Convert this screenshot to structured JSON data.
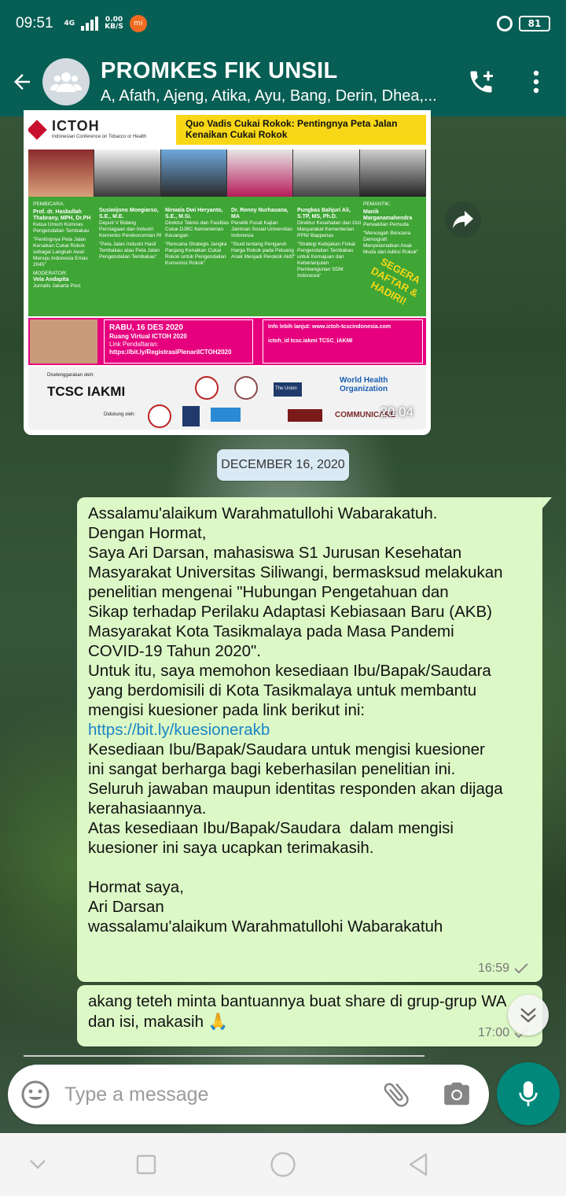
{
  "status_bar": {
    "time": "09:51",
    "network": "4G",
    "speed_value": "0.00",
    "speed_unit": "KB/S",
    "mi_label": "mi",
    "battery": "81"
  },
  "header": {
    "title": "PROMKES FIK UNSIL",
    "subtitle": "A, Afath, Ajeng, Atika, Ayu, Bang, Derin, Dhea,..."
  },
  "image_message": {
    "time": "20:04",
    "poster": {
      "logo": "ICTOH",
      "logo_sub": "Indonesian Conference on Tobacco or Health",
      "banner": "Quo Vadis Cukai Rokok: Pentingnya Peta Jalan Kenaikan Cukai Rokok",
      "speakers_label": "PEMBICARA:",
      "speakers": [
        {
          "name": "Prof. dr. Hasbullah Thabrany, MPH, Dr.PH",
          "role": "Ketua Umum Komnas Pengendalian Tembakau",
          "topic": "\"Pentingnya Peta Jalan Kenaikan Cukai Rokok sebagai Langkah Awal Menuju Indonesia Emas 2045\""
        },
        {
          "name": "Susiwijono Moegiarso, S.E., M.E.",
          "role": "Deputi V Bidang Perniagaan dan Industri Kemenko Perekonomian RI",
          "topic": "\"Peta Jalan Industri Hasil Tembakau atau Peta Jalan Pengendalian Tembakau\""
        },
        {
          "name": "Nirwala Dwi Heryanto, S.E., M.Si.",
          "role": "Direktur Teknis dan Fasilitas Cukai DJBC Kementerian Keuangan",
          "topic": "\"Rencana Strategis Jangka Panjang Kenaikan Cukai Rokok untuk Pengendalian Konsumsi Rokok\""
        },
        {
          "name": "Dr. Renny Nurhasana, MA",
          "role": "Peneliti Pusat Kajian Jaminan Sosial Universitas Indonesia",
          "topic": "\"Studi tentang Pengaruh Harga Rokok pada Peluang Anak Menjadi Perokok Aktif\""
        },
        {
          "name": "Pungkas Bahjuri Ali, S.TP, MS, Ph.D.",
          "role": "Direktur Kesehatan dan Gizi Masyarakat Kementerian PPN/ Bappenas",
          "topic": "\"Strategi Kebijakan Fiskal Pengendalian Tembakau untuk Kemajuan dan Keberlanjutan Pembangunan SDM Indonesia\""
        },
        {
          "name": "Manik Marganamahendra",
          "role": "Perwakilan Pemuda",
          "topic": "\"Mencegah Bencana Demografi: Menyelamatkan Anak Muda dari Adiksi Rokok\""
        }
      ],
      "commentator_label": "PEMANTIK:",
      "moderator_label": "MODERATOR:",
      "moderator": "Vela Andapita",
      "moderator_org": "Jurnalis Jakarta Post",
      "cta": "SEGERA DAFTAR & HADIRI!",
      "date": "RABU, 16 DES 2020",
      "venue": "Ruang Virtual ICTOH 2020",
      "link_label": "Link Pendaftaran:",
      "link": "https://bit.ly/RegistrasiPlenariICTOH2020",
      "info": "Info lebih lanjut: www.ictoh-tcscindonesia.com",
      "socials": "ictoh_id   tcsc.iakmi   TCSC_IAKMI",
      "organizer_label": "Diselenggarakan oleh:",
      "organizer": "TCSC IAKMI",
      "supported_label": "Didukung oleh:",
      "who": "World Health Organization",
      "union": "The Union",
      "communicare": "COMMUNICARE"
    }
  },
  "date_divider": "DECEMBER 16, 2020",
  "messages": [
    {
      "text_before_link": "Assalamu'alaikum Warahmatullohi Wabarakatuh.\nDengan Hormat,\nSaya Ari Darsan, mahasiswa S1 Jurusan Kesehatan\nMasyarakat Universitas Siliwangi, bermasksud melakukan\npenelitian mengenai \"Hubungan Pengetahuan dan\nSikap terhadap Perilaku Adaptasi Kebiasaan Baru (AKB)\nMasyarakat Kota Tasikmalaya pada Masa Pandemi\nCOVID-19 Tahun 2020\".\nUntuk itu, saya memohon kesediaan Ibu/Bapak/Saudara\nyang berdomisili di Kota Tasikmalaya untuk membantu\nmengisi kuesioner pada link berikut ini:\n",
      "link": "https://bit.ly/kuesionerakb",
      "text_after_link": "\nKesediaan Ibu/Bapak/Saudara untuk mengisi kuesioner\nini sangat berharga bagi keberhasilan penelitian ini.\nSeluruh jawaban maupun identitas responden akan dijaga\nkerahasiaannya.\nAtas kesediaan Ibu/Bapak/Saudara  dalam mengisi\nkuesioner ini saya ucapkan terimakasih.\n\nHormat saya,\nAri Darsan\nwassalamu'alaikum Warahmatullohi Wabarakatuh",
      "time": "16:59"
    },
    {
      "text": "akang teteh minta bantuannya buat share di grup-grup WA\ndan isi, makasih 🙏",
      "time": "17:00"
    }
  ],
  "input": {
    "placeholder": "Type a message"
  },
  "colors": {
    "header": "#075e54",
    "outgoing_bubble": "#dcf8c6",
    "link": "#1a85c7",
    "mic_button": "#00897b"
  },
  "icons": [
    "back-arrow-icon",
    "group-avatar-icon",
    "add-call-icon",
    "more-vert-icon",
    "forward-share-icon",
    "emoji-icon",
    "attach-icon",
    "camera-icon",
    "mic-icon",
    "chevron-double-down-icon",
    "nav-back-icon",
    "nav-home-icon",
    "nav-recents-icon"
  ]
}
